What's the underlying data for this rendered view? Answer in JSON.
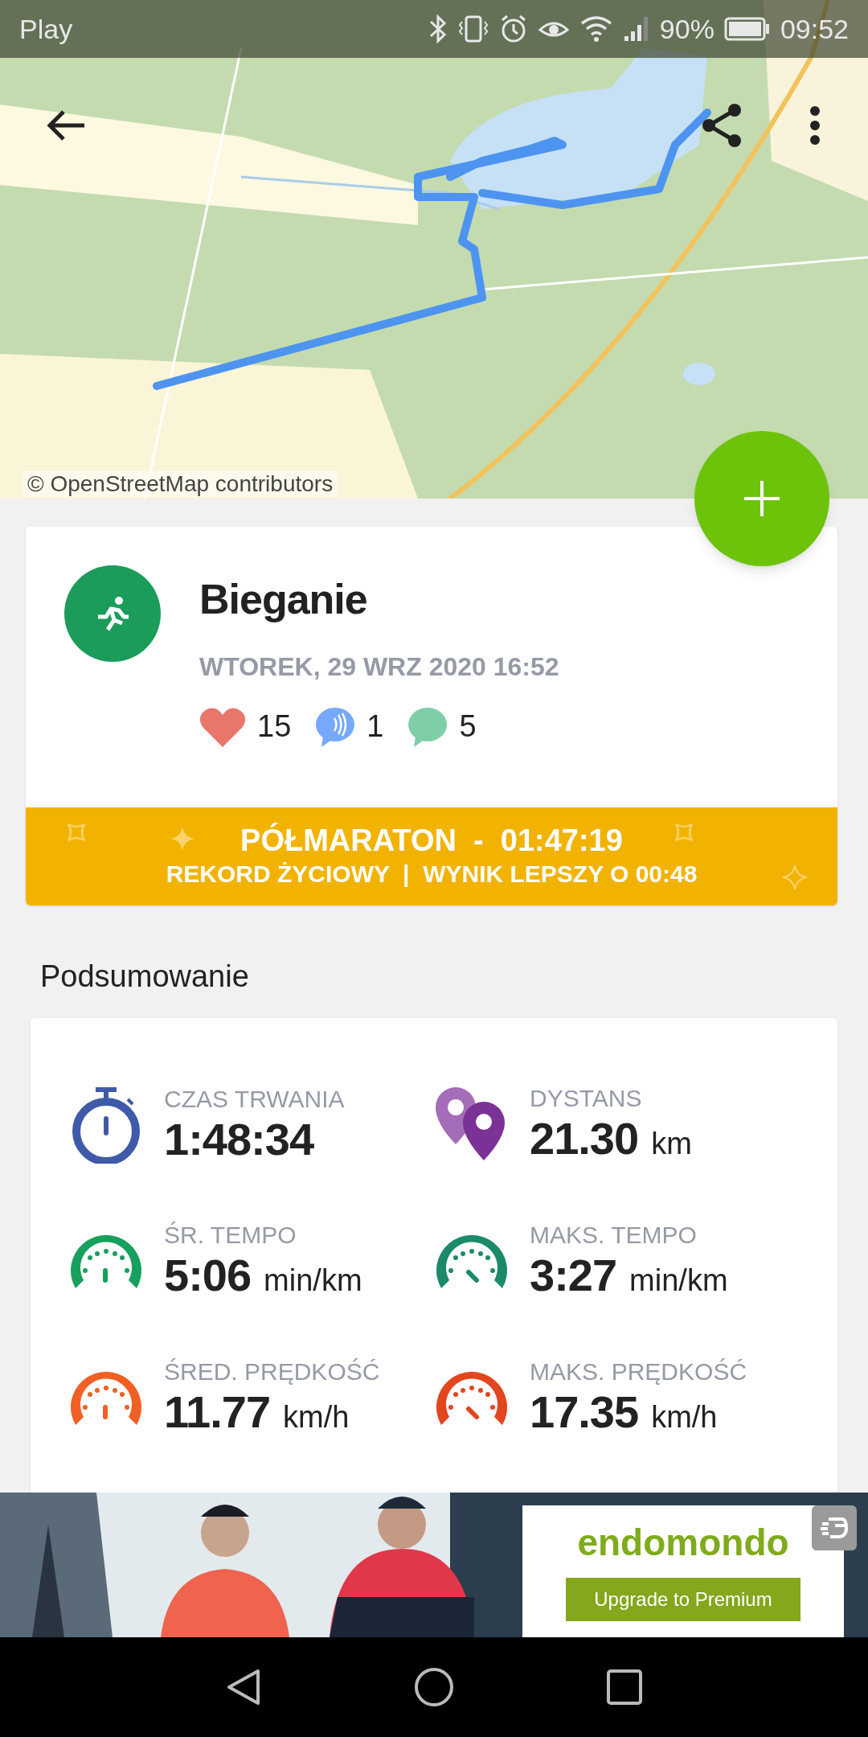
{
  "status_bar": {
    "carrier": "Play",
    "battery": "90%",
    "time": "09:52"
  },
  "map": {
    "attribution": "© OpenStreetMap contributors"
  },
  "activity": {
    "title": "Bieganie",
    "date": "WTOREK, 29 WRZ 2020 16:52",
    "counts": [
      {
        "kind": "likes",
        "count": "15"
      },
      {
        "kind": "peptalks",
        "count": "1"
      },
      {
        "kind": "comments",
        "count": "5"
      }
    ]
  },
  "record": {
    "title": "PÓŁMARATON  -  01:47:19",
    "subtitle": "REKORD ŻYCIOWY  |  WYNIK LEPSZY O 00:48"
  },
  "summary": {
    "heading": "Podsumowanie",
    "stats": [
      {
        "kind": "stopwatch",
        "color": "#3f5aa8",
        "label": "CZAS TRWANIA",
        "value": "1:48:34"
      },
      {
        "kind": "pins",
        "color": "#7b3296",
        "label": "DYSTANS",
        "value": "21.30",
        "unit": "km"
      },
      {
        "kind": "gauge-avg",
        "color": "#17a05d",
        "label": "ŚR. TEMPO",
        "value": "5:06",
        "unit": "min/km"
      },
      {
        "kind": "gauge-max",
        "color": "#1b8a6a",
        "label": "MAKS. TEMPO",
        "value": "3:27",
        "unit": "min/km"
      },
      {
        "kind": "gauge-avg",
        "color": "#f06025",
        "label": "ŚRED. PRĘDKOŚĆ",
        "value": "11.77",
        "unit": "km/h"
      },
      {
        "kind": "gauge-max",
        "color": "#e2461f",
        "label": "MAKS. PRĘDKOŚĆ",
        "value": "17.35",
        "unit": "km/h"
      }
    ]
  },
  "ad": {
    "brand": "endomondo",
    "button": "Upgrade to Premium"
  }
}
